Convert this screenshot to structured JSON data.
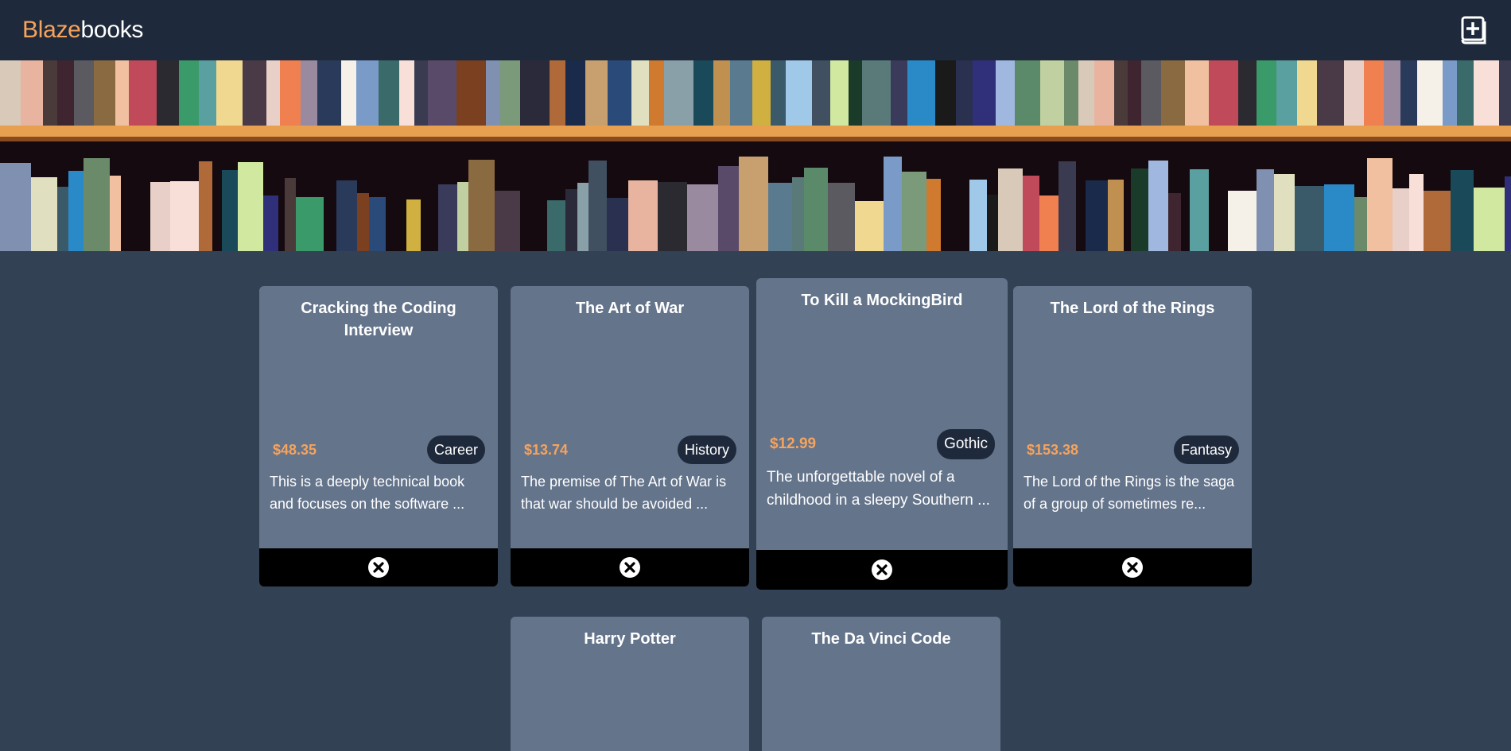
{
  "header": {
    "brand_part1": "Blaze",
    "brand_part2": "books",
    "add_button_icon": "add-book-icon"
  },
  "colors": {
    "accent": "#f6a35c",
    "navbar": "#1e293b",
    "background": "#334155",
    "card": "#64748b",
    "card_footer": "#000000"
  },
  "books": [
    {
      "title": "Cracking the Coding Interview",
      "price": "$48.35",
      "category": "Career",
      "description": "This is a deeply technical book and focuses on the software ..."
    },
    {
      "title": "The Art of War",
      "price": "$13.74",
      "category": "History",
      "description": "The premise of The Art of War is that war should be avoided ..."
    },
    {
      "title": "To Kill a MockingBird",
      "price": "$12.99",
      "category": "Gothic",
      "description": "The unforgettable novel of a childhood in a sleepy Southern ..."
    },
    {
      "title": "The Lord of the Rings",
      "price": "$153.38",
      "category": "Fantasy",
      "description": "The Lord of the Rings is the saga of a group of sometimes re..."
    },
    {
      "title": "Harry Potter"
    },
    {
      "title": "The Da Vinci Code"
    }
  ]
}
